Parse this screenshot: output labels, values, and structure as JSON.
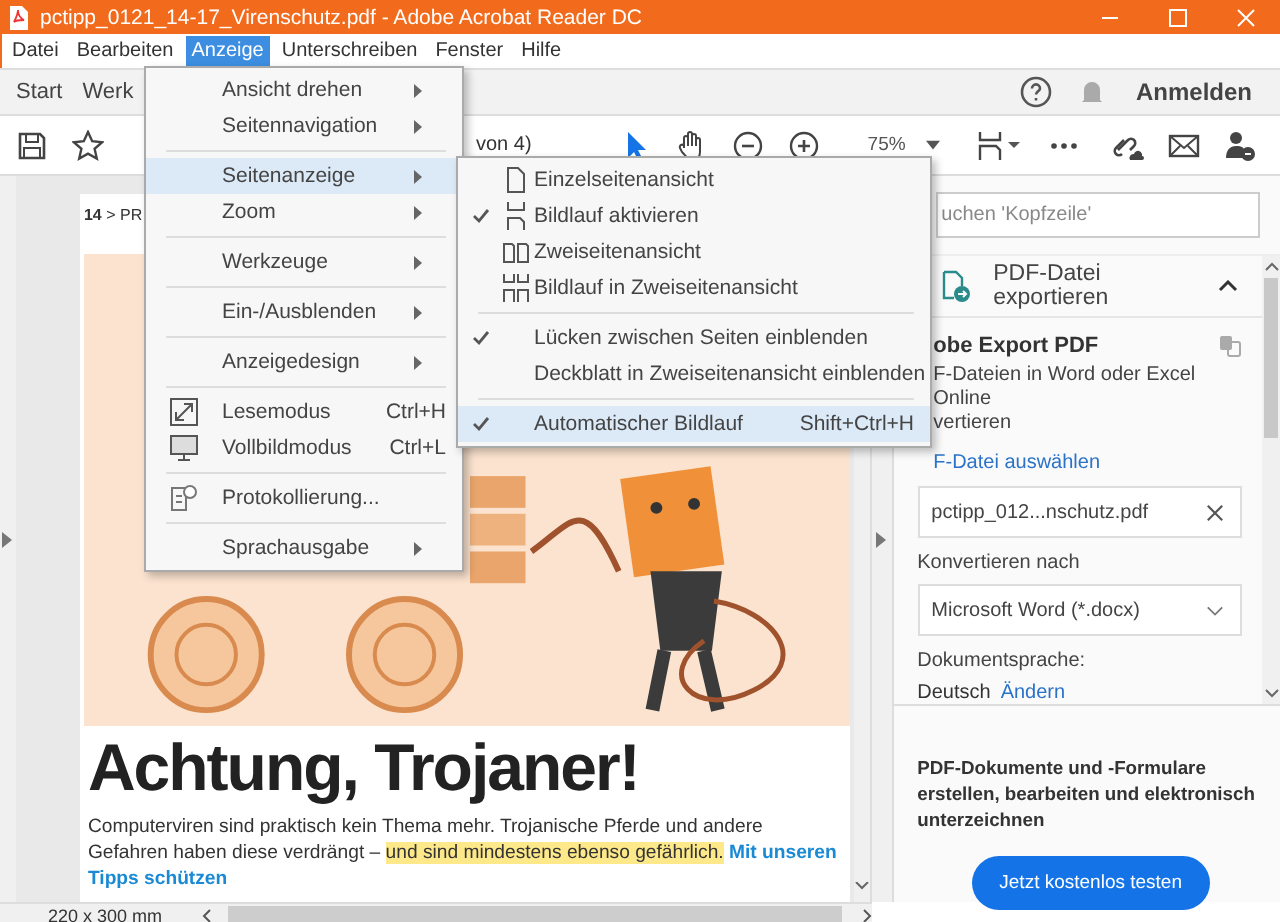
{
  "window": {
    "title": "pctipp_0121_14-17_Virenschutz.pdf - Adobe Acrobat Reader DC"
  },
  "menu_bar": [
    {
      "label": "Datei",
      "selected": false
    },
    {
      "label": "Bearbeiten",
      "selected": false
    },
    {
      "label": "Anzeige",
      "selected": true
    },
    {
      "label": "Unterschreiben",
      "selected": false
    },
    {
      "label": "Fenster",
      "selected": false
    },
    {
      "label": "Hilfe",
      "selected": false
    }
  ],
  "tabs": [
    "Start",
    "Werk"
  ],
  "account": {
    "sign_in": "Anmelden"
  },
  "toolbar": {
    "page_info": "von 4)",
    "zoom": "75%"
  },
  "view_menu": {
    "groups": [
      [
        {
          "label": "Ansicht drehen",
          "kind": "submenu",
          "selected": false
        },
        {
          "label": "Seitennavigation",
          "kind": "submenu",
          "selected": false
        }
      ],
      [
        {
          "label": "Seitenanzeige",
          "kind": "submenu",
          "selected": true
        },
        {
          "label": "Zoom",
          "kind": "submenu",
          "selected": false
        }
      ],
      [
        {
          "label": "Werkzeuge",
          "kind": "submenu",
          "selected": false
        }
      ],
      [
        {
          "label": "Ein-/Ausblenden",
          "kind": "submenu",
          "selected": false
        }
      ],
      [
        {
          "label": "Anzeigedesign",
          "kind": "submenu",
          "selected": false
        }
      ],
      [
        {
          "label": "Lesemodus",
          "kind": "command",
          "shortcut": "Ctrl+H",
          "selected": false
        },
        {
          "label": "Vollbildmodus",
          "kind": "command",
          "shortcut": "Ctrl+L",
          "selected": false
        }
      ],
      [
        {
          "label": "Protokollierung...",
          "kind": "command",
          "selected": false
        }
      ],
      [
        {
          "label": "Sprachausgabe",
          "kind": "submenu",
          "selected": false
        }
      ]
    ]
  },
  "page_display_menu": {
    "groups": [
      [
        {
          "label": "Einzelseitenansicht",
          "kind": "layout",
          "checked": false,
          "selected": false
        },
        {
          "label": "Bildlauf aktivieren",
          "kind": "layout",
          "checked": true,
          "selected": false
        },
        {
          "label": "Zweiseitenansicht",
          "kind": "layout",
          "checked": false,
          "selected": false
        },
        {
          "label": "Bildlauf in Zweiseitenansicht",
          "kind": "layout",
          "checked": false,
          "selected": false
        }
      ],
      [
        {
          "label": "Lücken zwischen Seiten einblenden",
          "kind": "option",
          "checked": true,
          "selected": false
        },
        {
          "label": "Deckblatt in Zweiseitenansicht einblenden",
          "kind": "option",
          "checked": false,
          "selected": false
        }
      ],
      [
        {
          "label": "Automatischer Bildlauf",
          "kind": "option",
          "checked": true,
          "selected": true,
          "shortcut": "Shift+Ctrl+H"
        }
      ]
    ]
  },
  "document": {
    "breadcrumb": "**14** > PR",
    "headline": "Achtung, Trojaner!",
    "paragraph": [
      {
        "text": "Computerviren sind praktisch kein Thema mehr. Trojanische Pferde und andere Gefahren haben diese verdrängt – ",
        "kind": "plain"
      },
      {
        "text": "und sind mindestens ebenso gefährlich.",
        "kind": "highlight"
      },
      {
        "text": " Mit unseren Tipps schützen",
        "kind": "link"
      }
    ]
  },
  "status_bar": {
    "page_size": "220 x 300 mm"
  },
  "right_panel": {
    "search": {
      "placeholder": "uchen 'Kopfzeile'"
    },
    "tool": {
      "title": "PDF-Datei exportieren",
      "expanded": true
    },
    "export": {
      "heading": "obe Export PDF",
      "description_lines": [
        "F-Dateien in Word oder Excel Online",
        "vertieren"
      ],
      "select_file_link": "F-Datei auswählen",
      "file": "pctipp_012...nschutz.pdf",
      "convert_label": "Konvertieren nach",
      "format": "Microsoft Word (*.docx)",
      "language_label": "Dokumentsprache:",
      "language": "Deutsch",
      "change_link": "Ändern"
    },
    "promo": {
      "text": "PDF-Dokumente und -Formulare erstellen, bearbeiten und elektronisch unterzeichnen",
      "button": "Jetzt kostenlos testen"
    }
  }
}
